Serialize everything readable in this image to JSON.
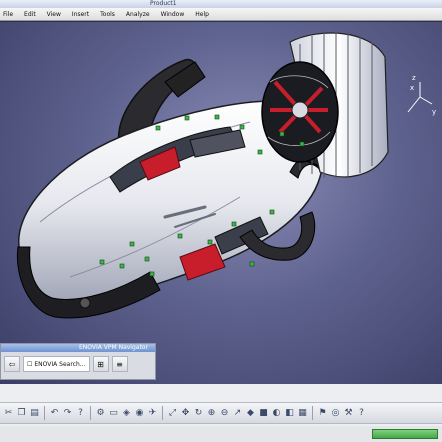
{
  "window": {
    "title": "Product1"
  },
  "menu": {
    "items": [
      "File",
      "Edit",
      "View",
      "Insert",
      "Tools",
      "Analyze",
      "Window",
      "Help"
    ]
  },
  "viewport": {
    "axes": {
      "x": "x",
      "y": "y",
      "z": "z"
    }
  },
  "navigation": {
    "title": "ENOVIA VPM Navigator",
    "search_label": "ENOVIA Search..."
  },
  "toolbar": {
    "icons": [
      "cut-icon",
      "copy-icon",
      "paste-icon",
      "undo-icon",
      "redo-icon",
      "what-is-this-icon",
      "assembly-icon",
      "ruler-icon",
      "measure-icon",
      "analysis-icon",
      "fly-mode-icon",
      "fit-all-icon",
      "pan-icon",
      "rotate-icon",
      "zoom-in-icon",
      "zoom-out-icon",
      "normal-view-icon",
      "iso-view-icon",
      "shading-icon",
      "hide-show-icon",
      "swap-space-icon",
      "filter-icon",
      "bookmark-icon",
      "camera-icon",
      "options-icon",
      "help-icon"
    ]
  },
  "colors": {
    "background_top": "#8c8fb8",
    "background_edge": "#3a3e66",
    "accent_red": "#c81e2b",
    "status_green": "#46a64a"
  }
}
